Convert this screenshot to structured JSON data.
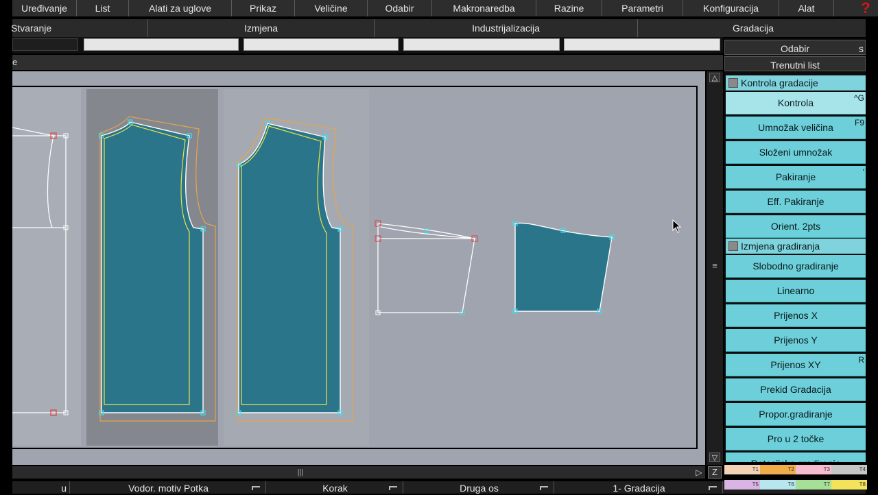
{
  "menu": {
    "items": [
      "Uređivanje",
      "List",
      "Alati za uglove",
      "Prikaz",
      "Veličine",
      "Odabir",
      "Makronaredba",
      "Razine",
      "Parametri",
      "Konfiguracija",
      "Alat"
    ],
    "help": "?"
  },
  "tabs": [
    "Stvaranje",
    "Izmjena",
    "Industrijalizacija",
    "Gradacija"
  ],
  "command_line": "e",
  "right_panel": {
    "header1": "Odabir",
    "header1_extra": "s",
    "header2": "Trenutni list",
    "category1": "Kontrola gradacije",
    "commands1": [
      {
        "label": "Kontrola",
        "shortcut": "^G",
        "active": true
      },
      {
        "label": "Umnožak veličina",
        "shortcut": "F9"
      },
      {
        "label": "Složeni umnožak",
        "shortcut": ""
      },
      {
        "label": "Pakiranje",
        "shortcut": "'"
      },
      {
        "label": "Eff. Pakiranje",
        "shortcut": ""
      },
      {
        "label": "Orient. 2pts",
        "shortcut": ""
      }
    ],
    "category2": "Izmjena gradiranja",
    "commands2": [
      {
        "label": "Slobodno gradiranje",
        "shortcut": ""
      },
      {
        "label": "Linearno",
        "shortcut": ""
      },
      {
        "label": "Prijenos X",
        "shortcut": ""
      },
      {
        "label": "Prijenos Y",
        "shortcut": ""
      },
      {
        "label": "Prijenos XY",
        "shortcut": "R"
      },
      {
        "label": "Prekid Gradacija",
        "shortcut": ""
      },
      {
        "label": "Propor.gradiranje",
        "shortcut": ""
      },
      {
        "label": "Pro u 2 točke",
        "shortcut": ""
      },
      {
        "label": "Rotacijsko gradiranje",
        "shortcut": ""
      }
    ]
  },
  "status": {
    "cell0": "u",
    "cell1": "Vodor. motiv Potka",
    "cell2": "Korak",
    "cell3": "Druga os",
    "cell4": "1- Gradacija"
  },
  "scroll": {
    "up": "△",
    "down": "▽",
    "grip": "≡",
    "hgrip": "|||",
    "right": "▷",
    "z": "Z"
  },
  "swatches_top": [
    {
      "label": "T1",
      "color": "#f3d2b6"
    },
    {
      "label": "T2",
      "color": "#f0ac4a"
    },
    {
      "label": "T3",
      "color": "#f7bcd0"
    },
    {
      "label": "T4",
      "color": "#c6c6c6"
    }
  ],
  "swatches_bottom": [
    {
      "label": "T5",
      "color": "#d9b4e4"
    },
    {
      "label": "T6",
      "color": "#b7e6ee"
    },
    {
      "label": "T7",
      "color": "#a6df96"
    },
    {
      "label": "T8",
      "color": "#f2e35a"
    }
  ],
  "colors": {
    "piece_fill": "#2a7589",
    "outline_white": "#ffffff",
    "outline_yellow": "#f0e24a",
    "outline_orange": "#e9a34a",
    "point_cyan": "#3fe0ee",
    "point_red": "#e04040"
  }
}
